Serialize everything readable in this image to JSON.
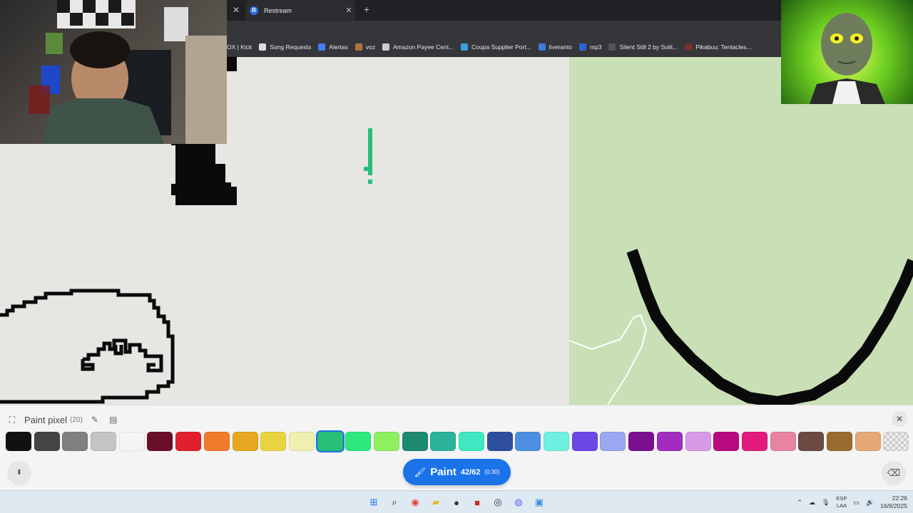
{
  "browser": {
    "tab_title": "Restream",
    "tab_favicon": "R",
    "bookmarks": [
      {
        "label": "OX | Kick",
        "icon": "kick-icon",
        "color": "#35363a"
      },
      {
        "label": "Song Requests",
        "icon": "paw-icon",
        "color": "#dddddd"
      },
      {
        "label": "Alertas",
        "icon": "alert-icon",
        "color": "#4a7bff"
      },
      {
        "label": "voz",
        "icon": "voice-icon",
        "color": "#b0743a"
      },
      {
        "label": "Amazon Payee Cent...",
        "icon": "globe-icon",
        "color": "#cccccc"
      },
      {
        "label": "Coupa Supplier Port...",
        "icon": "coupa-icon",
        "color": "#3aa0e0"
      },
      {
        "label": "liveranto",
        "icon": "liveranto-icon",
        "color": "#3a7be0"
      },
      {
        "label": "mp3",
        "icon": "mp3-icon",
        "color": "#2b64d8"
      },
      {
        "label": "Silent Still 2 by Solit...",
        "icon": "itch-icon",
        "color": "#555555"
      },
      {
        "label": "Pikabuu: Tentacles...",
        "icon": "pikabuu-icon",
        "color": "#7a3030"
      }
    ]
  },
  "panel": {
    "title": "Paint pixel",
    "count": "(20)",
    "paint_label": "Paint",
    "paint_count": "42/62",
    "paint_timer": "(0:30)",
    "palette": [
      "#111111",
      "#444444",
      "#808080",
      "#c4c4c4",
      "#f5f5f5",
      "#6a0f2a",
      "#e0202d",
      "#f07b2a",
      "#e6a820",
      "#e8d440",
      "#efefb0",
      "#27c07a",
      "#2ee87e",
      "#8ef061",
      "#1e8a70",
      "#2ab39a",
      "#3fe8c0",
      "#2e4f9e",
      "#4c8fe0",
      "#6df0e0",
      "#6b48e6",
      "#99a8f0",
      "#7a1090",
      "#a22cc0",
      "#d69ae6",
      "#b80a80",
      "#e31a7e",
      "#e8849f",
      "#6a4a42",
      "#9a6b2e",
      "#e6a878",
      "transparent"
    ],
    "selected_index": 11
  },
  "taskbar": {
    "apps": [
      {
        "name": "windows-start-icon",
        "glyph": "⊞",
        "color": "#1a73e8"
      },
      {
        "name": "search-icon",
        "glyph": "⌕",
        "color": "#222222"
      },
      {
        "name": "chrome-icon",
        "glyph": "◉",
        "color": "#e34133"
      },
      {
        "name": "file-explorer-icon",
        "glyph": "▰",
        "color": "#e9b52c"
      },
      {
        "name": "obs-icon",
        "glyph": "●",
        "color": "#333333"
      },
      {
        "name": "app-red-icon",
        "glyph": "■",
        "color": "#c92a2a"
      },
      {
        "name": "steam-icon",
        "glyph": "◎",
        "color": "#1b2838"
      },
      {
        "name": "discord-icon",
        "glyph": "◍",
        "color": "#5865f2"
      },
      {
        "name": "paint-app-icon",
        "glyph": "▣",
        "color": "#3a8ee0"
      }
    ],
    "lang_top": "ESP",
    "lang_bottom": "LAA",
    "time": "22:26",
    "date": "16/8/2025"
  }
}
